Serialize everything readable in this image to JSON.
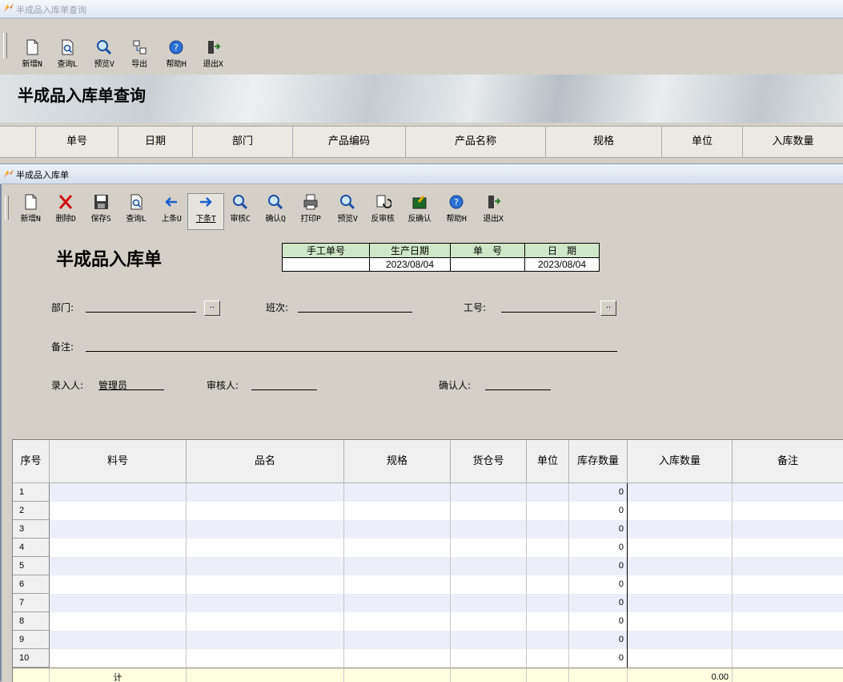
{
  "outer": {
    "window_title": "半成品入库单查询",
    "toolbar": [
      {
        "label": "新增N",
        "icon": "new-doc-icon"
      },
      {
        "label": "查询L",
        "icon": "query-icon"
      },
      {
        "label": "预览V",
        "icon": "preview-icon"
      },
      {
        "label": "导出",
        "icon": "export-icon"
      },
      {
        "label": "帮助H",
        "icon": "help-icon"
      },
      {
        "label": "退出X",
        "icon": "exit-icon"
      }
    ],
    "banner_title": "半成品入库单查询",
    "columns": [
      "单号",
      "日期",
      "部门",
      "产品编码",
      "产品名称",
      "规格",
      "单位",
      "入库数量"
    ]
  },
  "inner": {
    "window_title": "半成品入库单",
    "toolbar": [
      {
        "label": "新增N",
        "icon": "new-doc-icon"
      },
      {
        "label": "删除D",
        "icon": "delete-icon"
      },
      {
        "label": "保存S",
        "icon": "save-icon"
      },
      {
        "label": "查询L",
        "icon": "query-icon"
      },
      {
        "label": "上条U",
        "icon": "prev-arrow-icon"
      },
      {
        "label": "下条T",
        "icon": "next-arrow-icon"
      },
      {
        "label": "审核C",
        "icon": "audit-icon"
      },
      {
        "label": "确认Q",
        "icon": "confirm-icon"
      },
      {
        "label": "打印P",
        "icon": "print-icon"
      },
      {
        "label": "预览V",
        "icon": "preview-icon"
      },
      {
        "label": "反审核",
        "icon": "unaudit-icon"
      },
      {
        "label": "反确认",
        "icon": "unconfirm-icon"
      },
      {
        "label": "帮助H",
        "icon": "help-icon"
      },
      {
        "label": "退出X",
        "icon": "exit-icon"
      }
    ],
    "form_title": "半成品入库单",
    "info_table": {
      "headers": [
        "手工单号",
        "生产日期",
        "单　号",
        "日　期"
      ],
      "values": [
        "",
        "2023/08/04",
        "",
        "2023/08/04"
      ]
    },
    "fields": {
      "dept_label": "部门:",
      "dept_value": "",
      "ellipsis": "..",
      "shift_label": "班次:",
      "shift_value": "",
      "workno_label": "工号:",
      "workno_value": "",
      "remark_label": "备注:",
      "remark_value": "",
      "entry_label": "录入人:",
      "entry_value": "管理员",
      "auditor_label": "审核人:",
      "auditor_value": "",
      "confirmer_label": "确认人:",
      "confirmer_value": ""
    },
    "grid": {
      "columns": [
        "序号",
        "料号",
        "品名",
        "规格",
        "货仓号",
        "单位",
        "库存数量",
        "入库数量",
        "备注"
      ],
      "rows": [
        {
          "no": "1",
          "stock": "0"
        },
        {
          "no": "2",
          "stock": "0"
        },
        {
          "no": "3",
          "stock": "0"
        },
        {
          "no": "4",
          "stock": "0"
        },
        {
          "no": "5",
          "stock": "0"
        },
        {
          "no": "6",
          "stock": "0"
        },
        {
          "no": "7",
          "stock": "0"
        },
        {
          "no": "8",
          "stock": "0"
        },
        {
          "no": "9",
          "stock": "0"
        },
        {
          "no": "10",
          "stock": "0"
        }
      ],
      "total_label": "计",
      "total_qty": "0.00"
    }
  },
  "colors": {
    "info_header_bg": "#cfe6c8",
    "row_alt_bg": "#eeeefa",
    "total_bg": "#ffffe0"
  }
}
